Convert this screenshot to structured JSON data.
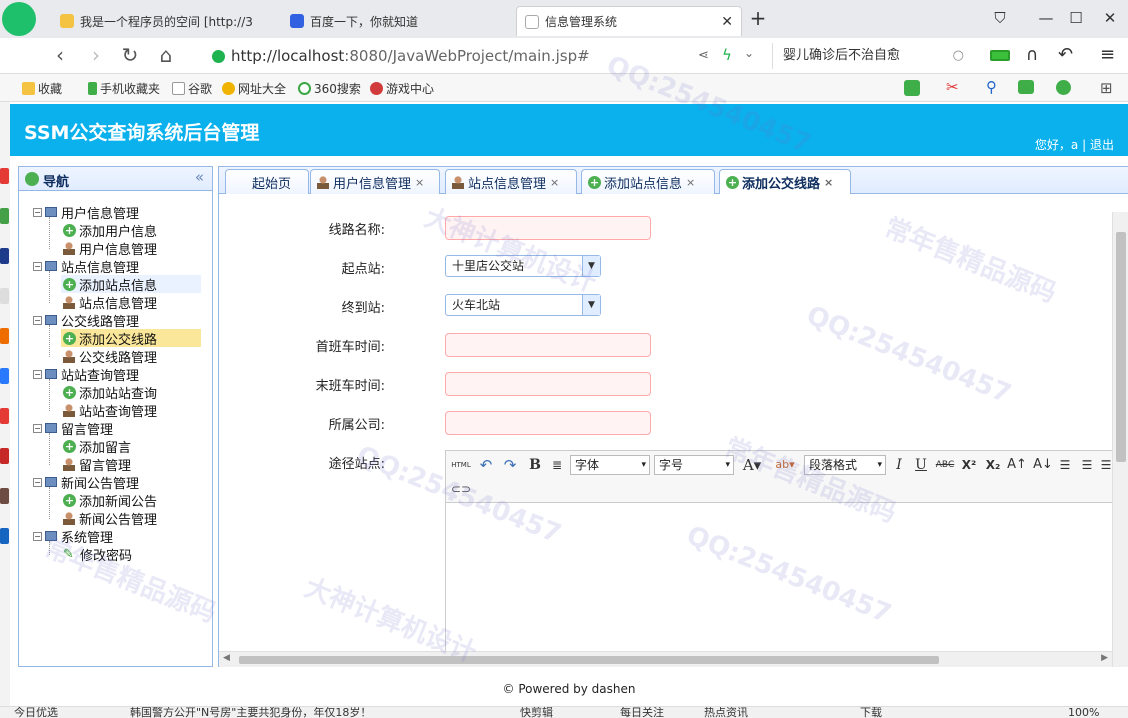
{
  "browser": {
    "tabs": [
      {
        "label": "我是一个程序员的空间 [http://3"
      },
      {
        "label": "百度一下，你就知道"
      },
      {
        "label": "信息管理系统"
      }
    ],
    "url_host": "http://localhost",
    "url_rest": ":8080/JavaWebProject/main.jsp#",
    "search_text": "婴儿确诊后不治自愈",
    "favorites": [
      "收藏",
      "手机收藏夹",
      "谷歌",
      "网址大全",
      "360搜索",
      "游戏中心"
    ]
  },
  "app": {
    "title": "SSM公交查询系统后台管理",
    "greeting": "您好，a",
    "separator": "|",
    "logout": "退出"
  },
  "nav": {
    "header": "导航",
    "collapse_glyph": "«",
    "groups": [
      {
        "label": "用户信息管理",
        "items": [
          {
            "label": "添加用户信息"
          },
          {
            "label": "用户信息管理"
          }
        ]
      },
      {
        "label": "站点信息管理",
        "items": [
          {
            "label": "添加站点信息"
          },
          {
            "label": "站点信息管理"
          }
        ]
      },
      {
        "label": "公交线路管理",
        "items": [
          {
            "label": "添加公交线路"
          },
          {
            "label": "公交线路管理"
          }
        ]
      },
      {
        "label": "站站查询管理",
        "items": [
          {
            "label": "添加站站查询"
          },
          {
            "label": "站站查询管理"
          }
        ]
      },
      {
        "label": "留言管理",
        "items": [
          {
            "label": "添加留言"
          },
          {
            "label": "留言管理"
          }
        ]
      },
      {
        "label": "新闻公告管理",
        "items": [
          {
            "label": "添加新闻公告"
          },
          {
            "label": "新闻公告管理"
          }
        ]
      },
      {
        "label": "系统管理",
        "items": [
          {
            "label": "修改密码"
          }
        ]
      }
    ]
  },
  "tabs": [
    {
      "label": "起始页"
    },
    {
      "label": "用户信息管理"
    },
    {
      "label": "站点信息管理"
    },
    {
      "label": "添加站点信息"
    },
    {
      "label": "添加公交线路"
    }
  ],
  "tab_close": "×",
  "form": {
    "line_name_label": "线路名称:",
    "start_label": "起点站:",
    "start_value": "十里店公交站",
    "end_label": "终到站:",
    "end_value": "火车北站",
    "first_bus_label": "首班车时间:",
    "last_bus_label": "末班车时间:",
    "company_label": "所属公司:",
    "route_label": "途径站点:"
  },
  "editor": {
    "html_btn": "HTML",
    "font_label": "字体",
    "size_label": "字号",
    "format_label": "段落格式",
    "bold": "B",
    "italic": "I",
    "underline": "U",
    "strike": "ABC",
    "sup": "X²",
    "sub": "X₂"
  },
  "footer": "© Powered by dashen",
  "statusbar": {
    "left": "今日优选",
    "news": "韩国警方公开\"N号房\"主要共犯身份，年仅18岁！",
    "items": [
      "快剪辑",
      "每日关注",
      "热点资讯",
      "下载"
    ],
    "zoom": "100%"
  },
  "watermarks": [
    "常年售精品源码",
    "QQ:254540457",
    "大神计算机设计"
  ]
}
